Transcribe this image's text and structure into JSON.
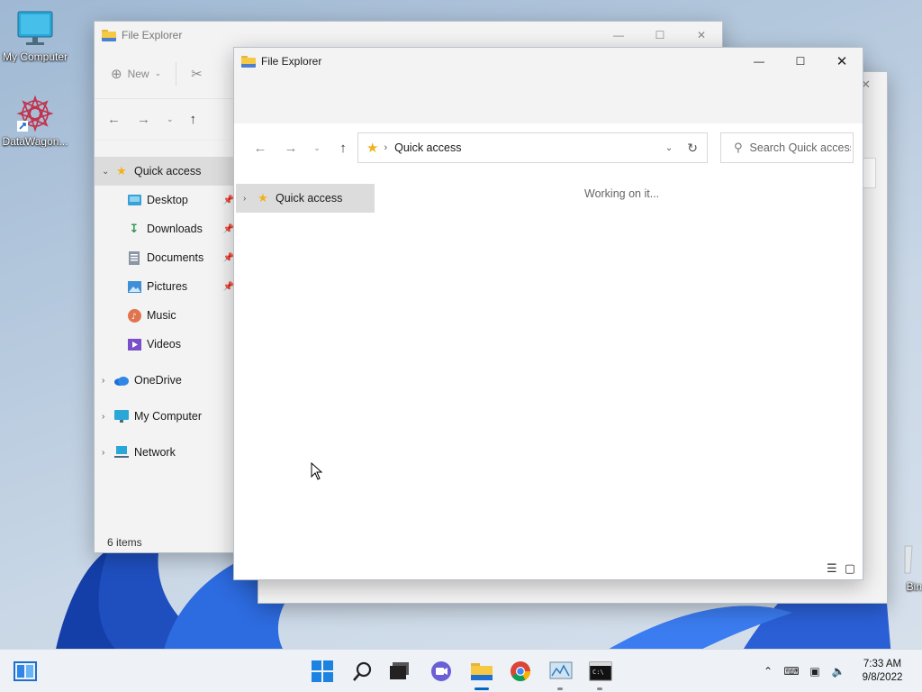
{
  "desktop": {
    "icons": [
      {
        "label": "My Computer"
      },
      {
        "label": "DataWagon..."
      },
      {
        "label": "Bin"
      }
    ]
  },
  "back_window": {
    "title": "File Explorer",
    "toolbar": {
      "new_label": "New"
    },
    "nav": {
      "quick_access": "Quick access",
      "desktop": "Desktop",
      "downloads": "Downloads",
      "documents": "Documents",
      "pictures": "Pictures",
      "music": "Music",
      "videos": "Videos",
      "onedrive": "OneDrive",
      "my_computer": "My Computer",
      "network": "Network"
    },
    "status": "6 items"
  },
  "front_window": {
    "title": "File Explorer",
    "address": {
      "location": "Quick access"
    },
    "search": {
      "placeholder": "Search Quick access"
    },
    "nav": {
      "quick_access": "Quick access"
    },
    "content": {
      "status_text": "Working on it..."
    }
  },
  "taskbar": {
    "apps": [
      "start-icon",
      "search-icon",
      "task-view-icon",
      "chat-icon",
      "file-explorer-icon",
      "chrome-icon",
      "monitor-app-icon",
      "terminal-icon"
    ],
    "clock": {
      "time": "7:33 AM",
      "date": "9/8/2022"
    }
  },
  "colors": {
    "accent": "#0067c0",
    "star": "#f2b11b",
    "folder": "#f6c945"
  }
}
